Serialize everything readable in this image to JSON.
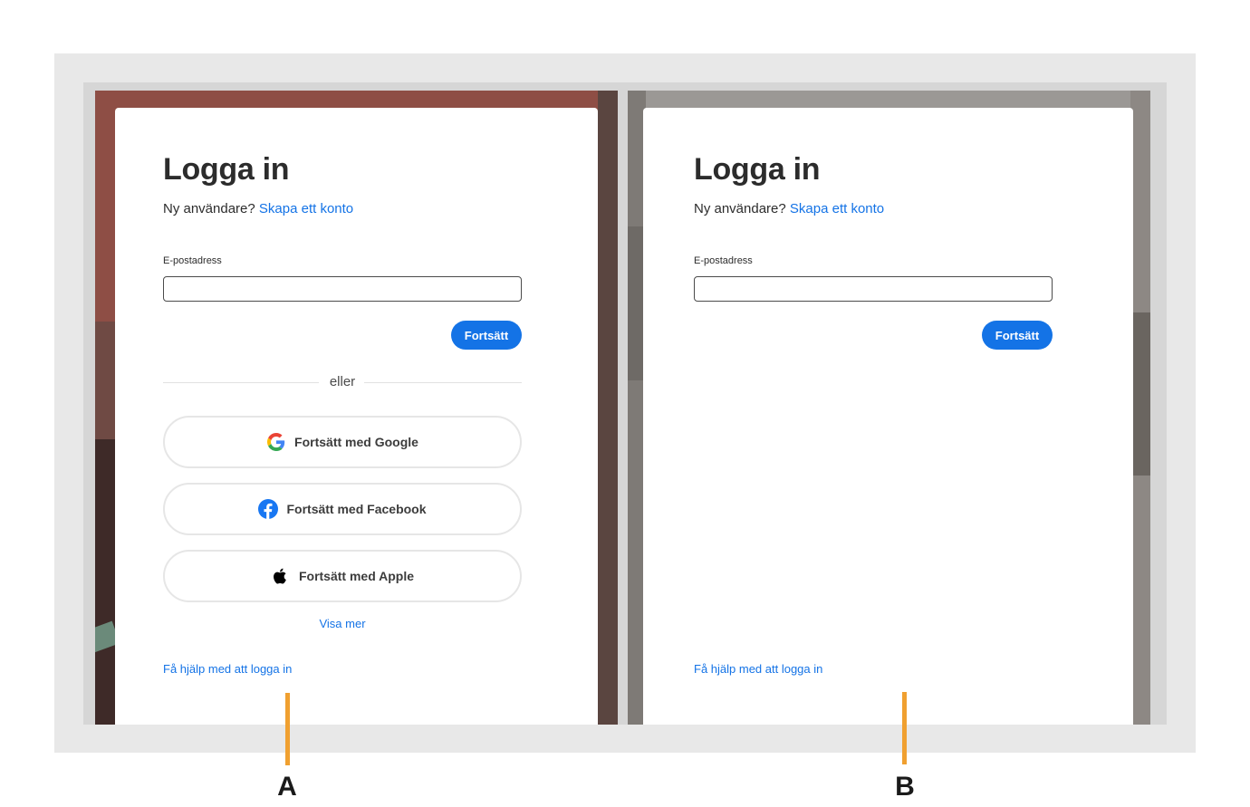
{
  "panel_a": {
    "title": "Logga in",
    "new_user_text": "Ny användare?",
    "create_account_link": "Skapa ett konto",
    "email_label": "E-postadress",
    "email_value": "",
    "continue_label": "Fortsätt",
    "divider_text": "eller",
    "google_label": "Fortsätt med Google",
    "facebook_label": "Fortsätt med Facebook",
    "apple_label": "Fortsätt med Apple",
    "show_more_link": "Visa mer",
    "help_link": "Få hjälp med att logga in"
  },
  "panel_b": {
    "title": "Logga in",
    "new_user_text": "Ny användare?",
    "create_account_link": "Skapa ett konto",
    "email_label": "E-postadress",
    "email_value": "",
    "continue_label": "Fortsätt",
    "help_link": "Få hjälp med att logga in"
  },
  "markers": {
    "a": "A",
    "b": "B"
  },
  "colors": {
    "accent": "#1473e6",
    "marker": "#f0a030"
  },
  "icons": {
    "google": "google-icon",
    "facebook": "facebook-icon",
    "apple": "apple-icon"
  }
}
